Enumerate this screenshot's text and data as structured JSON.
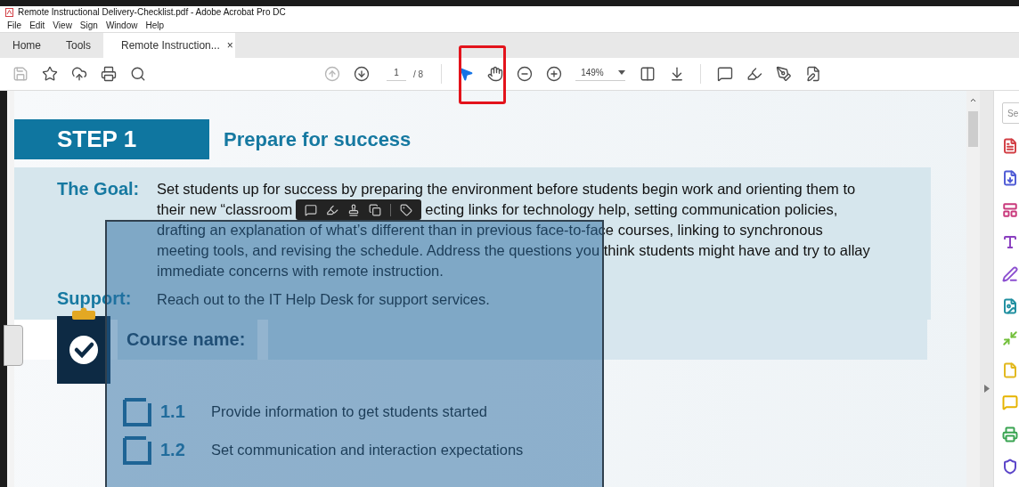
{
  "window": {
    "title": "Remote Instructional Delivery-Checklist.pdf - Adobe Acrobat Pro DC"
  },
  "menu": [
    "File",
    "Edit",
    "View",
    "Sign",
    "Window",
    "Help"
  ],
  "tabs": [
    {
      "label": "Home",
      "selected": false
    },
    {
      "label": "Tools",
      "selected": false
    },
    {
      "label": "Remote Instruction...",
      "selected": true,
      "close": "×"
    }
  ],
  "toolbar": [
    {
      "kind": "save",
      "disabled": true,
      "selected": false
    },
    {
      "kind": "bookmark",
      "disabled": false,
      "selected": false
    },
    {
      "kind": "upload",
      "disabled": false,
      "selected": false
    },
    {
      "kind": "print",
      "disabled": false,
      "selected": false
    },
    {
      "kind": "find",
      "disabled": false,
      "selected": false
    },
    {
      "kind": "gap"
    },
    {
      "kind": "prev-page",
      "disabled": true,
      "selected": false
    },
    {
      "kind": "next-page",
      "disabled": false,
      "selected": false
    },
    {
      "kind": "page",
      "value": "1",
      "total": "/ 8"
    },
    {
      "kind": "separator"
    },
    {
      "kind": "select",
      "disabled": false,
      "selected": true
    },
    {
      "kind": "hand",
      "disabled": false,
      "selected": false
    },
    {
      "kind": "zoom-out",
      "disabled": false,
      "selected": false
    },
    {
      "kind": "zoom-in",
      "disabled": false,
      "selected": false
    },
    {
      "kind": "zoom",
      "value": "149%"
    },
    {
      "kind": "fit",
      "disabled": false,
      "selected": false
    },
    {
      "kind": "scroll",
      "disabled": false,
      "selected": false
    },
    {
      "kind": "separator"
    },
    {
      "kind": "comment",
      "disabled": false,
      "selected": false
    },
    {
      "kind": "highlight",
      "disabled": false,
      "selected": false
    },
    {
      "kind": "sign",
      "disabled": false,
      "selected": false
    },
    {
      "kind": "fill",
      "disabled": false,
      "selected": false
    }
  ],
  "document": {
    "step": "STEP 1",
    "heading": "Prepare for success",
    "goal_label": "The Goal:",
    "goal_lines": [
      [
        "Set students up for success by preparing the environment before students begin work and orienting them to"
      ],
      [
        "their new “classroom",
        "ecting links for technology help, setting communication policies,"
      ],
      [
        "drafting an explanation of what’s different than in previous face-to-face courses, linking to synchronous"
      ],
      [
        "meeting tools, and revising the schedule.  Address the questions you think students might have and try to allay"
      ],
      [
        "immediate concerns with remote instruction."
      ]
    ],
    "support_label": "Support:",
    "support_text": "Reach out to the IT Help Desk for support services.",
    "course_label": "Course name:",
    "checklist": [
      {
        "number": "1.1",
        "text": "Provide information to get students started",
        "checked": false
      },
      {
        "number": "1.2",
        "text": "Set communication and interaction expectations",
        "checked": false
      }
    ]
  },
  "tools_pane": {
    "search_placeholder": "Se",
    "tools": [
      {
        "kind": "export",
        "color": "#d23f45"
      },
      {
        "kind": "create",
        "color": "#4f5bd5"
      },
      {
        "kind": "organize",
        "color": "#c93a7c"
      },
      {
        "kind": "edit",
        "color": "#8a3fc0"
      },
      {
        "kind": "fill-sign",
        "color": "#8c4fd0"
      },
      {
        "kind": "combine",
        "color": "#1f8fa0"
      },
      {
        "kind": "compress",
        "color": "#72bf3a"
      },
      {
        "kind": "pages",
        "color": "#e2b81c"
      },
      {
        "kind": "comment",
        "color": "#e6b400"
      },
      {
        "kind": "scan",
        "color": "#3aa452"
      },
      {
        "kind": "protect",
        "color": "#5a44c8"
      }
    ]
  }
}
